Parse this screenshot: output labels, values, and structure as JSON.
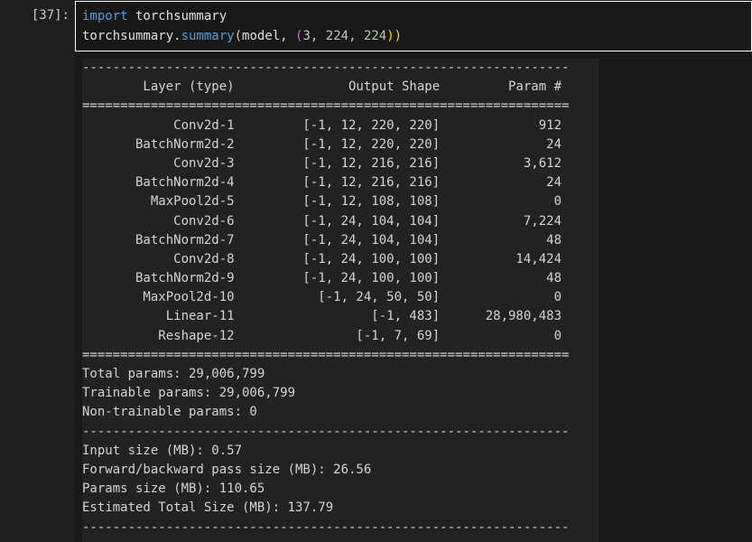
{
  "cell": {
    "prompt": "[37]:",
    "code": {
      "line1_keyword": "import",
      "line1_module": " torchsummary",
      "line2_module": "torchsummary.",
      "line2_fn": "summary",
      "line2_open": "(",
      "line2_arg": "model, ",
      "line2_tuple_open": "(",
      "line2_n1": "3",
      "line2_sep1": ", ",
      "line2_n2": "224",
      "line2_sep2": ", ",
      "line2_n3": "224",
      "line2_close": "))"
    }
  },
  "output": {
    "separator_dash": "----------------------------------------------------------------",
    "separator_eq": "================================================================",
    "header": "        Layer (type)               Output Shape         Param #",
    "rows": [
      "            Conv2d-1         [-1, 12, 220, 220]             912",
      "       BatchNorm2d-2         [-1, 12, 220, 220]              24",
      "            Conv2d-3         [-1, 12, 216, 216]           3,612",
      "       BatchNorm2d-4         [-1, 12, 216, 216]              24",
      "         MaxPool2d-5         [-1, 12, 108, 108]               0",
      "            Conv2d-6         [-1, 24, 104, 104]           7,224",
      "       BatchNorm2d-7         [-1, 24, 104, 104]              48",
      "            Conv2d-8         [-1, 24, 100, 100]          14,424",
      "       BatchNorm2d-9         [-1, 24, 100, 100]              48",
      "        MaxPool2d-10           [-1, 24, 50, 50]               0",
      "           Linear-11                  [-1, 483]      28,980,483",
      "          Reshape-12                [-1, 7, 69]               0"
    ],
    "total_params": "Total params: 29,006,799",
    "trainable_params": "Trainable params: 29,006,799",
    "non_trainable_params": "Non-trainable params: 0",
    "input_size": "Input size (MB): 0.57",
    "forward_backward_size": "Forward/backward pass size (MB): 26.56",
    "params_size": "Params size (MB): 110.65",
    "estimated_total_size": "Estimated Total Size (MB): 137.79"
  }
}
